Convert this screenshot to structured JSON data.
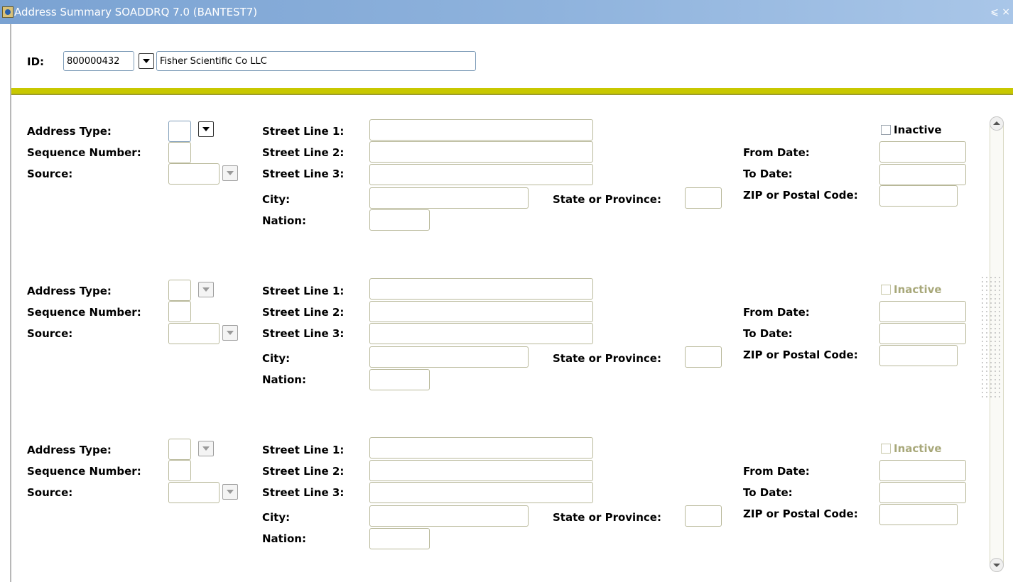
{
  "window": {
    "title": "Address Summary  SOADDRQ  7.0  (BANTEST7)",
    "controls": "⩽ ×"
  },
  "id_section": {
    "label": "ID:",
    "id_value": "800000432",
    "name_value": "Fisher Scientific Co LLC"
  },
  "labels": {
    "address_type": "Address Type:",
    "sequence_number": "Sequence Number:",
    "source": "Source:",
    "street_line_1": "Street Line 1:",
    "street_line_2": "Street Line 2:",
    "street_line_3": "Street Line 3:",
    "city": "City:",
    "nation": "Nation:",
    "state_or_province": "State or Province:",
    "inactive": "Inactive",
    "from_date": "From Date:",
    "to_date": "To Date:",
    "zip_or_postal_code": "ZIP or Postal Code:"
  },
  "records": [
    {
      "address_type": "",
      "sequence_number": "",
      "source": "",
      "street_line_1": "",
      "street_line_2": "",
      "street_line_3": "",
      "city": "",
      "state_or_province": "",
      "nation": "",
      "inactive": false,
      "from_date": "",
      "to_date": "",
      "zip": ""
    },
    {
      "address_type": "",
      "sequence_number": "",
      "source": "",
      "street_line_1": "",
      "street_line_2": "",
      "street_line_3": "",
      "city": "",
      "state_or_province": "",
      "nation": "",
      "inactive": false,
      "from_date": "",
      "to_date": "",
      "zip": ""
    },
    {
      "address_type": "",
      "sequence_number": "",
      "source": "",
      "street_line_1": "",
      "street_line_2": "",
      "street_line_3": "",
      "city": "",
      "state_or_province": "",
      "nation": "",
      "inactive": false,
      "from_date": "",
      "to_date": "",
      "zip": ""
    }
  ],
  "colors": {
    "title_bar": "#7aa2d2",
    "divider": "#c8c800",
    "inactive_disabled_text": "#a8a87a"
  }
}
